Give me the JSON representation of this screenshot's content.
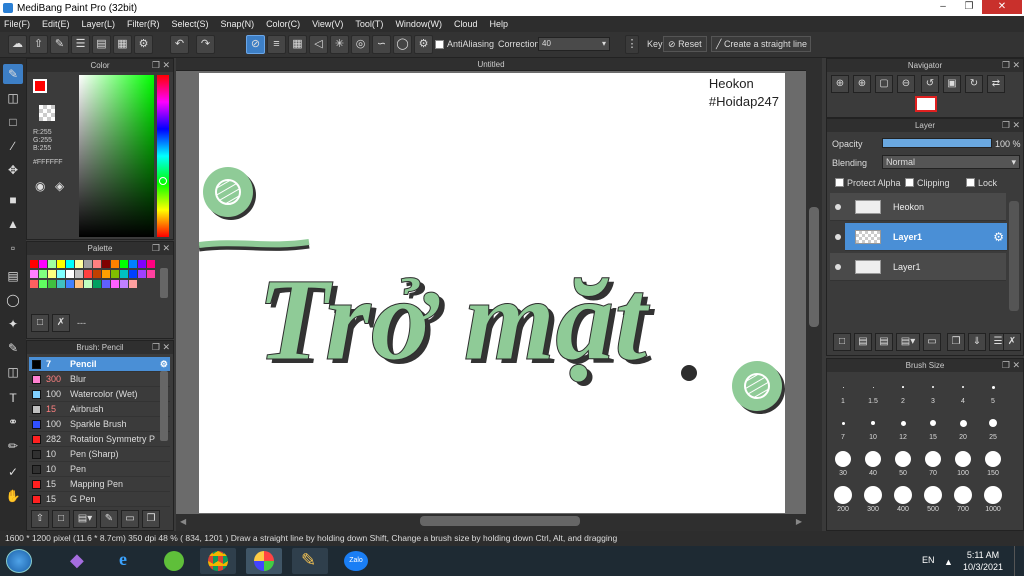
{
  "window": {
    "title": "MediBang Paint Pro (32bit)"
  },
  "menu": [
    "File(F)",
    "Edit(E)",
    "Layer(L)",
    "Filter(R)",
    "Select(S)",
    "Snap(N)",
    "Color(C)",
    "View(V)",
    "Tool(T)",
    "Window(W)",
    "Cloud",
    "Help"
  ],
  "toolbar": {
    "antialiasing_label": "AntiAliasing",
    "correction_label": "Correction",
    "correction_value": "40",
    "key_label": "Key",
    "reset_label": "Reset",
    "straight_line_label": "Create a straight line"
  },
  "color_panel": {
    "title": "Color",
    "r": "R:255",
    "g": "G:255",
    "b": "B:255",
    "hex": "#FFFFFF",
    "primary": "#ff0000"
  },
  "palette_panel": {
    "title": "Palette",
    "dash": "---",
    "colors": [
      "#ff0000",
      "#ff00ff",
      "#a0ffa0",
      "#ffff00",
      "#00ffff",
      "#ffffa0",
      "#a0a0a0",
      "#ff8080",
      "#800000",
      "#ff8000",
      "#00ff00",
      "#0080ff",
      "#8000ff",
      "#ff0080",
      "#ff80ff",
      "#80ff80",
      "#ffff80",
      "#80ffff",
      "#ffffff",
      "#c0c0c0",
      "#ff4040",
      "#c04000",
      "#ffa000",
      "#80c000",
      "#00c0c0",
      "#0040ff",
      "#a040ff",
      "#ff40a0",
      "#ff6060",
      "#60ff60",
      "#40c040",
      "#40c0c0",
      "#4080ff",
      "#ffc080",
      "#c0ffc0",
      "#00a060",
      "#6060ff",
      "#ff60ff",
      "#c080ff",
      "#ffa0a0"
    ]
  },
  "brush_panel": {
    "title": "Brush: Pencil",
    "items": [
      {
        "color": "#000000",
        "size": "7",
        "name": "Pencil",
        "selected": true
      },
      {
        "color": "#ff80d0",
        "size": "300",
        "name": "Blur"
      },
      {
        "color": "#80d0ff",
        "size": "100",
        "name": "Watercolor (Wet)"
      },
      {
        "color": "#c0c0c0",
        "size": "15",
        "name": "Airbrush"
      },
      {
        "color": "#3050ff",
        "size": "100",
        "name": "Sparkle Brush"
      },
      {
        "color": "#ff2020",
        "size": "282",
        "name": "Rotation Symmetry P"
      },
      {
        "color": "#303030",
        "size": "10",
        "name": "Pen (Sharp)"
      },
      {
        "color": "#303030",
        "size": "10",
        "name": "Pen"
      },
      {
        "color": "#ff2020",
        "size": "15",
        "name": "Mapping Pen"
      },
      {
        "color": "#ff2020",
        "size": "15",
        "name": "G Pen"
      }
    ]
  },
  "document": {
    "tab": "Untitled",
    "watermark_line1": "Heokon",
    "watermark_line2": "#Hoidap247",
    "artwork_text": "Trở mặt"
  },
  "navigator": {
    "title": "Navigator"
  },
  "layer_panel": {
    "title": "Layer",
    "opacity_label": "Opacity",
    "opacity_value": "100 %",
    "opacity_fraction": 1.0,
    "blending_label": "Blending",
    "blending_value": "Normal",
    "protect_alpha": "Protect Alpha",
    "clipping": "Clipping",
    "lock": "Lock",
    "layers": [
      {
        "name": "Heokon"
      },
      {
        "name": "Layer1",
        "selected": true
      },
      {
        "name": "Layer1"
      }
    ]
  },
  "brush_size_panel": {
    "title": "Brush Size",
    "sizes": [
      "1",
      "1.5",
      "2",
      "3",
      "4",
      "5",
      "7",
      "10",
      "12",
      "15",
      "20",
      "25",
      "30",
      "40",
      "50",
      "70",
      "100",
      "150",
      "200",
      "300",
      "400",
      "500",
      "700",
      "1000"
    ]
  },
  "status": {
    "text": "1600 * 1200 pixel   (11.6 * 8.7cm)  350 dpi   48 %   ( 834, 1201 )   Draw a straight line by holding down Shift, Change a brush size by holding down Ctrl, Alt, and dragging"
  },
  "taskbar": {
    "lang": "EN",
    "time": "5:11 AM",
    "date": "10/3/2021",
    "zalo": "Zalo"
  }
}
